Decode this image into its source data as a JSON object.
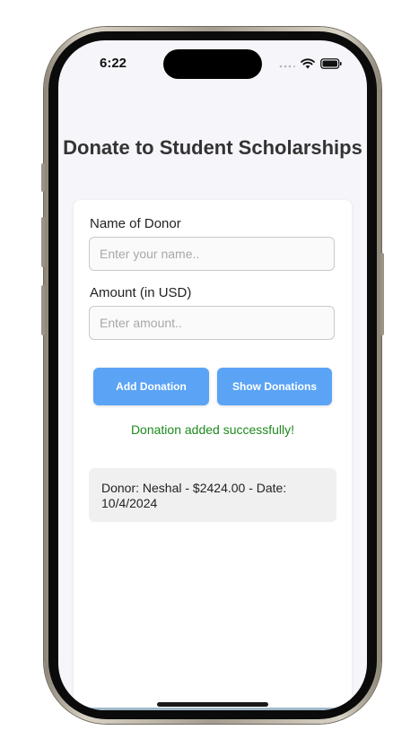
{
  "status_bar": {
    "time": "6:22"
  },
  "page": {
    "title": "Donate to Student Scholarships"
  },
  "form": {
    "name_label": "Name of Donor",
    "name_placeholder": "Enter your name..",
    "name_value": "",
    "amount_label": "Amount (in USD)",
    "amount_placeholder": "Enter amount..",
    "amount_value": ""
  },
  "buttons": {
    "add_label": "Add Donation",
    "show_label": "Show Donations"
  },
  "message": {
    "success": "Donation added successfully!"
  },
  "donations": [
    {
      "text": "Donor: Neshal - $2424.00 - Date: 10/4/2024"
    }
  ],
  "colors": {
    "accent": "#5aa3f5",
    "success": "#1d8a1d"
  }
}
